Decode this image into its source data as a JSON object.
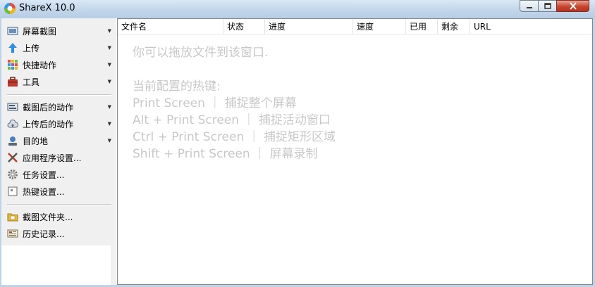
{
  "window": {
    "title": "ShareX 10.0",
    "icon": "sharex-logo-icon"
  },
  "sidebar": {
    "items": [
      {
        "label": "屏幕截图",
        "icon": "screen-capture-icon",
        "dropdown": true
      },
      {
        "label": "上传",
        "icon": "upload-arrow-icon",
        "dropdown": true
      },
      {
        "label": "快捷动作",
        "icon": "grid-icon",
        "dropdown": true
      },
      {
        "label": "工具",
        "icon": "toolbox-icon",
        "dropdown": true
      },
      {
        "label": "截图后的动作",
        "icon": "after-capture-icon",
        "dropdown": true
      },
      {
        "label": "上传后的动作",
        "icon": "cloud-upload-icon",
        "dropdown": true
      },
      {
        "label": "目的地",
        "icon": "destination-icon",
        "dropdown": true
      },
      {
        "label": "应用程序设置...",
        "icon": "tools-wrench-icon",
        "dropdown": false
      },
      {
        "label": "任务设置...",
        "icon": "gear-icon",
        "dropdown": false
      },
      {
        "label": "热键设置...",
        "icon": "keyboard-icon",
        "dropdown": false
      },
      {
        "label": "截图文件夹...",
        "icon": "folder-icon",
        "dropdown": false
      },
      {
        "label": "历史记录...",
        "icon": "history-icon",
        "dropdown": false
      }
    ]
  },
  "list": {
    "columns": [
      "文件名",
      "状态",
      "进度",
      "速度",
      "已用",
      "剩余",
      "URL"
    ]
  },
  "hint": {
    "drop": "你可以拖放文件到该窗口.",
    "hotkeys_title": "当前配置的热键:",
    "hotkeys": [
      "Print Screen ｜ 捕捉整个屏幕",
      "Alt + Print Screen ｜ 捕捉活动窗口",
      "Ctrl + Print Screen ｜ 捕捉矩形区域",
      "Shift + Print Screen ｜ 屏幕录制"
    ]
  }
}
